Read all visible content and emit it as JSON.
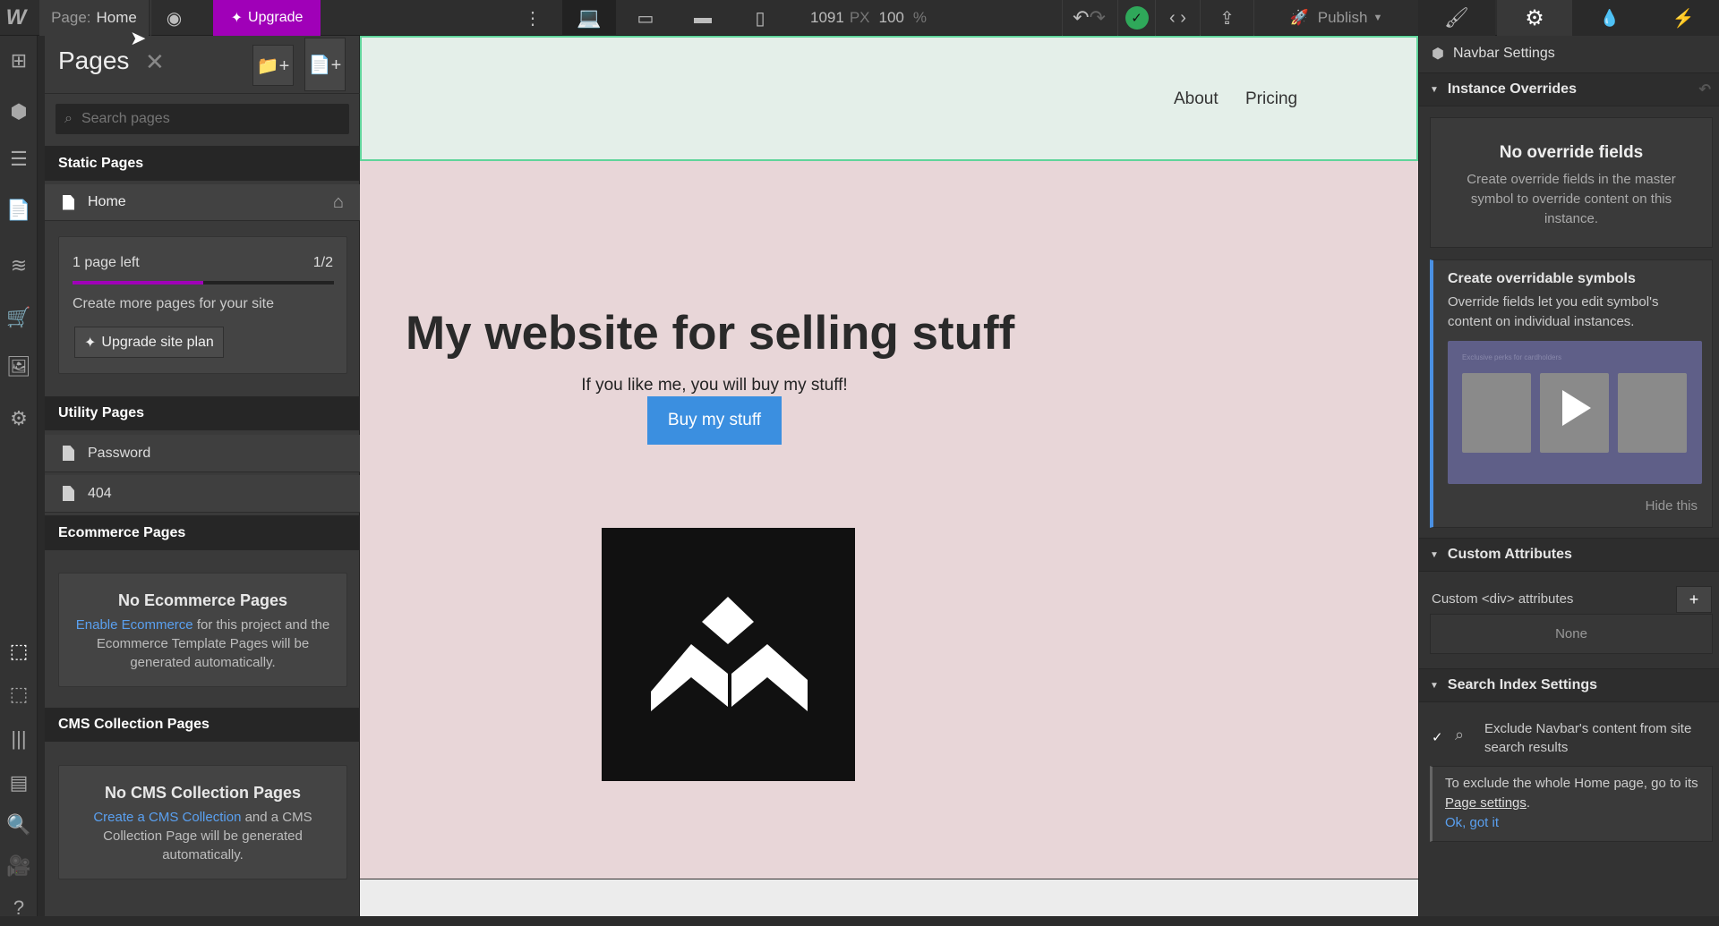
{
  "topbar": {
    "logo": "W",
    "page_label": "Page:",
    "page_name": "Home",
    "upgrade": "Upgrade",
    "width": "1091",
    "width_unit": "PX",
    "zoom": "100",
    "zoom_unit": "%",
    "publish": "Publish",
    "upgrade_color": "#a000b8"
  },
  "pages_panel": {
    "title": "Pages",
    "search_placeholder": "Search pages",
    "static_header": "Static Pages",
    "home": "Home",
    "plan_card": {
      "left": "1 page left",
      "count": "1/2",
      "progress_fraction": 0.5,
      "text": "Create more pages for your site",
      "button": "Upgrade site plan"
    },
    "utility_header": "Utility Pages",
    "utility_items": [
      "Password",
      "404"
    ],
    "ecom_header": "Ecommerce Pages",
    "ecom_card": {
      "title": "No Ecommerce Pages",
      "link": "Enable Ecommerce",
      "text": " for this project and the Ecommerce Template Pages will be generated automatically."
    },
    "cms_header": "CMS Collection Pages",
    "cms_card": {
      "title": "No CMS Collection Pages",
      "link": "Create a CMS Collection",
      "text": " and a CMS Collection Page will be generated automatically."
    }
  },
  "canvas": {
    "nav_links": [
      "About",
      "Pricing"
    ],
    "heading": "My website for selling stuff",
    "subtitle": "If you like me, you will buy my stuff!",
    "button": "Buy my stuff",
    "button_color": "#3b8fe0"
  },
  "right_panel": {
    "title": "Navbar Settings",
    "instance_header": "Instance Overrides",
    "no_override_title": "No override fields",
    "no_override_text": "Create override fields in the master symbol to override content on this instance.",
    "promo_title": "Create overridable symbols",
    "promo_text": "Override fields let you edit symbol's content on individual instances.",
    "promo_video_caption": "Exclusive perks for cardholders",
    "hide": "Hide this",
    "custom_header": "Custom Attributes",
    "custom_label": "Custom <div> attributes",
    "none": "None",
    "search_header": "Search Index Settings",
    "exclude_label": "Exclude Navbar's content from site search results",
    "exclude_checked": true,
    "info_text_1": "To exclude the whole Home page, go to its ",
    "info_link": "Page settings",
    "info_text_2": ".",
    "ok": "Ok, got it"
  }
}
